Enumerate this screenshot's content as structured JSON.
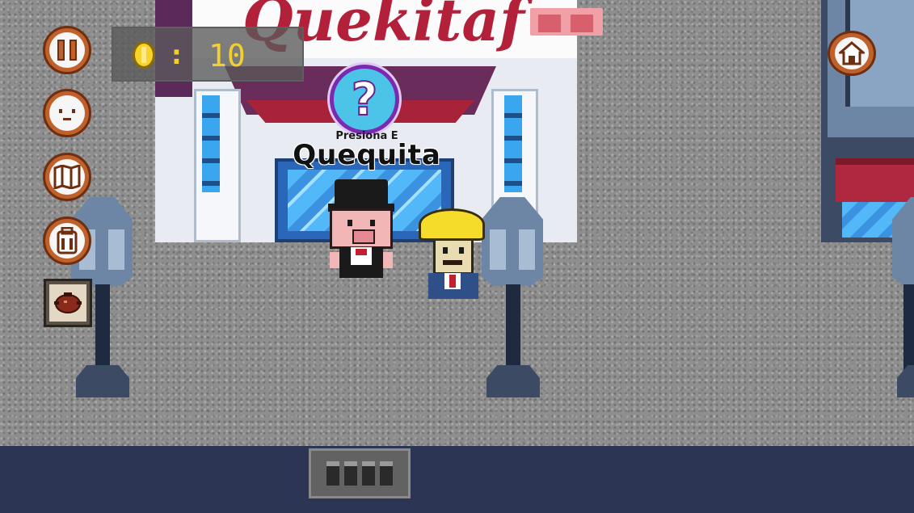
{
  "store": {
    "sign_text": "Quekitaf",
    "name": "Quequita"
  },
  "interaction": {
    "hint_symbol": "?",
    "press_text": "Presiona  E"
  },
  "hud": {
    "coins": {
      "icon": "coin-icon",
      "separator": ":",
      "count": "10"
    },
    "left_buttons": [
      {
        "name": "pause",
        "icon": "pause-icon"
      },
      {
        "name": "face",
        "icon": "face-icon"
      },
      {
        "name": "map",
        "icon": "map-icon"
      },
      {
        "name": "backpack",
        "icon": "backpack-icon"
      },
      {
        "name": "cooking-pot",
        "icon": "pot-icon"
      }
    ],
    "right_buttons": [
      {
        "name": "home",
        "icon": "home-icon"
      }
    ]
  },
  "colors": {
    "hud_button": "#c0602a",
    "coin_text": "#f3d030",
    "bottom_bar": "#2c3654",
    "sign_red": "#b2203a"
  }
}
